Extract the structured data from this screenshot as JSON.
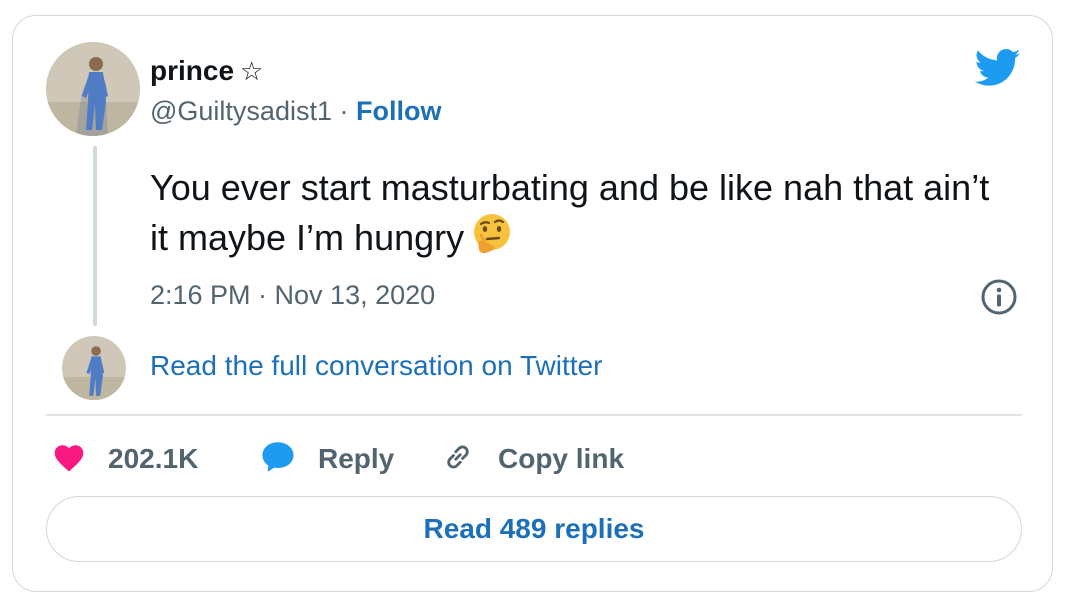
{
  "author": {
    "name": "prince",
    "name_symbol": "☆",
    "handle": "@Guiltysadist1",
    "separator": "·",
    "follow_label": "Follow"
  },
  "tweet": {
    "text": "You ever start masturbating and be like nah that ain’t it maybe I’m hungry",
    "emoji": "thinking-face",
    "timestamp": "2:16 PM · Nov 13, 2020"
  },
  "conversation_link": "Read the full conversation on Twitter",
  "actions": {
    "likes": "202.1K",
    "reply": "Reply",
    "copy_link": "Copy link"
  },
  "read_replies": "Read 489 replies",
  "icons": [
    "twitter-bird-icon",
    "info-icon",
    "heart-icon",
    "reply-bubble-icon",
    "link-icon"
  ],
  "colors": {
    "link": "#1d70b8",
    "twitter_blue": "#1d9bf0",
    "heart": "#f91880",
    "muted": "#536471",
    "border": "#cfd9de"
  }
}
